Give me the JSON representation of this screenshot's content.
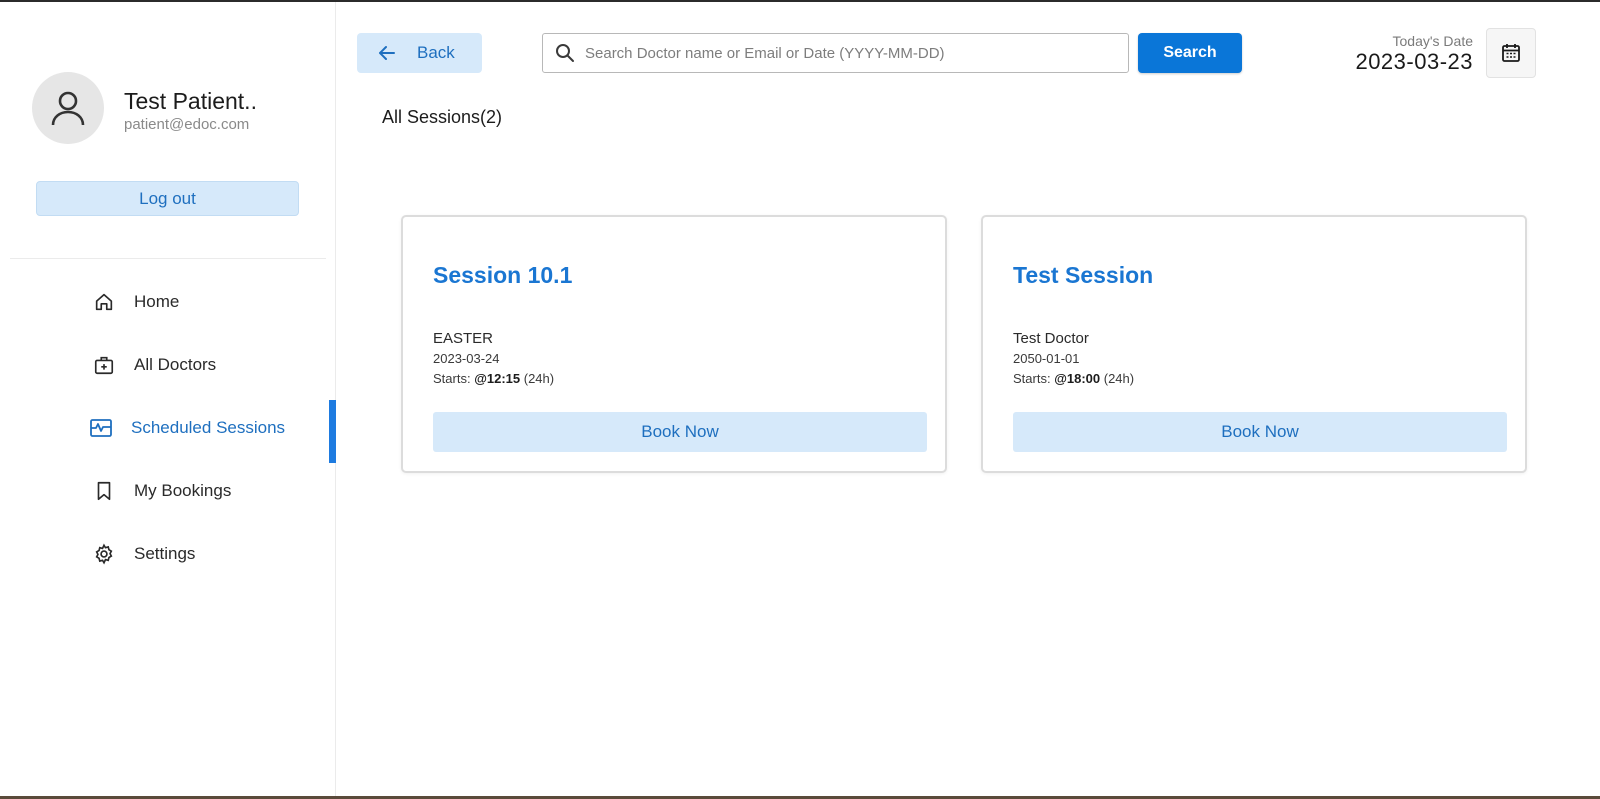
{
  "sidebar": {
    "profile": {
      "name": "Test Patient..",
      "email": "patient@edoc.com"
    },
    "logout_label": "Log out",
    "items": [
      {
        "label": "Home",
        "icon": "home-icon"
      },
      {
        "label": "All Doctors",
        "icon": "medical-bag-icon"
      },
      {
        "label": "Scheduled Sessions",
        "icon": "schedule-pulse-icon",
        "active": true
      },
      {
        "label": "My Bookings",
        "icon": "bookmark-icon"
      },
      {
        "label": "Settings",
        "icon": "gear-icon"
      }
    ]
  },
  "header": {
    "back_label": "Back",
    "search": {
      "placeholder": "Search Doctor name or Email or Date (YYYY-MM-DD)",
      "value": ""
    },
    "search_button_label": "Search",
    "today_label": "Today's Date",
    "today_value": "2023-03-23"
  },
  "main": {
    "section_title": "All Sessions(2)",
    "sessions": [
      {
        "title": "Session 10.1",
        "doctor": "EASTER",
        "date": "2023-03-24",
        "starts_prefix": "Starts: ",
        "time": "@12:15",
        "time_suffix": " (24h)",
        "book_label": "Book Now"
      },
      {
        "title": "Test Session",
        "doctor": "Test Doctor",
        "date": "2050-01-01",
        "starts_prefix": "Starts: ",
        "time": "@18:00",
        "time_suffix": " (24h)",
        "book_label": "Book Now"
      }
    ]
  },
  "colors": {
    "accent": "#0a76d8",
    "accent_text": "#1e6fbf",
    "light_accent": "#d6e9fa"
  }
}
